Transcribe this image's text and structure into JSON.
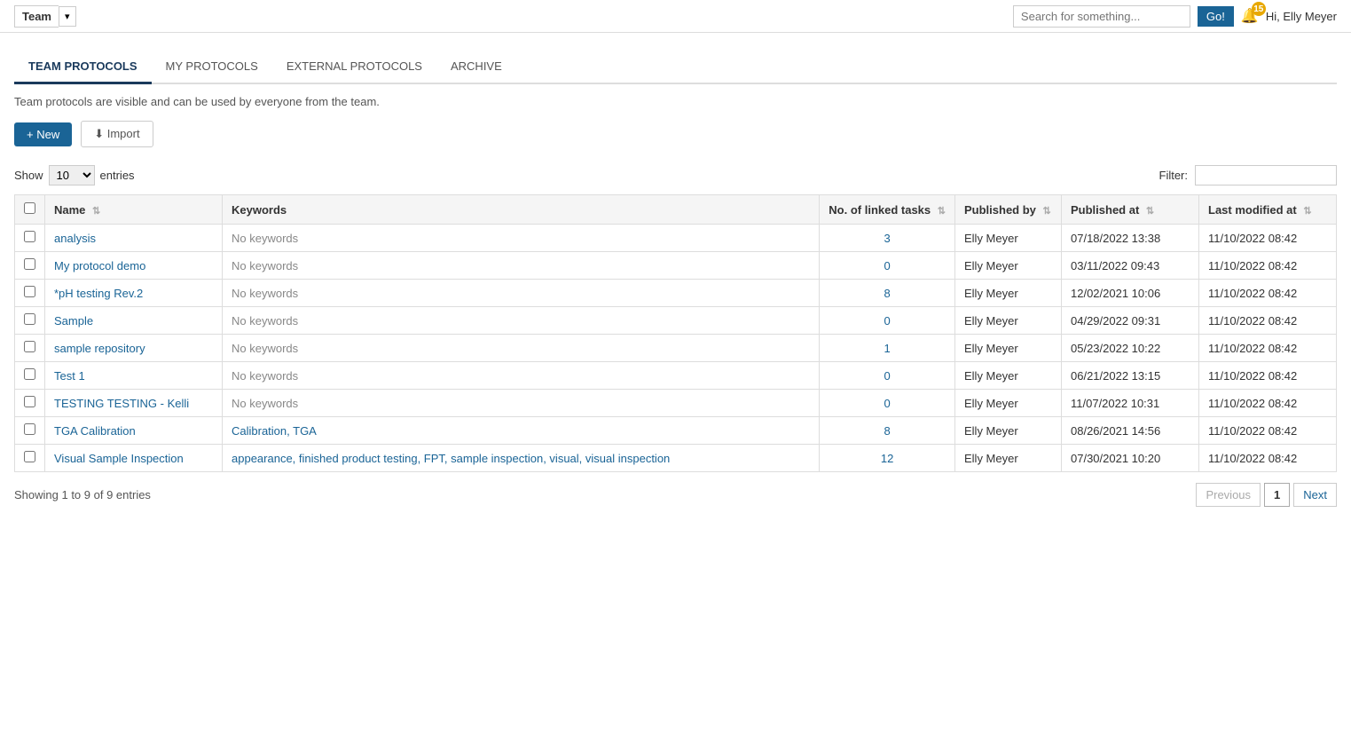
{
  "header": {
    "team_label": "Team",
    "dropdown_icon": "▾",
    "search_placeholder": "Search for something...",
    "go_label": "Go!",
    "notification_count": "15",
    "user_greeting": "Hi, Elly Meyer"
  },
  "tabs": [
    {
      "id": "team-protocols",
      "label": "TEAM PROTOCOLS",
      "active": true
    },
    {
      "id": "my-protocols",
      "label": "MY PROTOCOLS",
      "active": false
    },
    {
      "id": "external-protocols",
      "label": "EXTERNAL PROTOCOLS",
      "active": false
    },
    {
      "id": "archive",
      "label": "ARCHIVE",
      "active": false
    }
  ],
  "description": "Team protocols are visible and can be used by everyone from the team.",
  "buttons": {
    "new_label": "+ New",
    "import_label": "⬇ Import"
  },
  "table_controls": {
    "show_label": "Show",
    "entries_label": "entries",
    "entries_value": "10",
    "filter_label": "Filter:"
  },
  "table": {
    "columns": [
      {
        "id": "checkbox",
        "label": ""
      },
      {
        "id": "name",
        "label": "Name"
      },
      {
        "id": "keywords",
        "label": "Keywords"
      },
      {
        "id": "linked_tasks",
        "label": "No. of linked tasks"
      },
      {
        "id": "published_by",
        "label": "Published by"
      },
      {
        "id": "published_at",
        "label": "Published at"
      },
      {
        "id": "last_modified",
        "label": "Last modified at"
      }
    ],
    "rows": [
      {
        "name": "analysis",
        "keywords": "No keywords",
        "linked_tasks": "3",
        "published_by": "Elly Meyer",
        "published_at": "07/18/2022 13:38",
        "last_modified": "11/10/2022 08:42"
      },
      {
        "name": "My protocol demo",
        "keywords": "No keywords",
        "linked_tasks": "0",
        "published_by": "Elly Meyer",
        "published_at": "03/11/2022 09:43",
        "last_modified": "11/10/2022 08:42"
      },
      {
        "name": "*pH testing Rev.2",
        "keywords": "No keywords",
        "linked_tasks": "8",
        "published_by": "Elly Meyer",
        "published_at": "12/02/2021 10:06",
        "last_modified": "11/10/2022 08:42"
      },
      {
        "name": "Sample",
        "keywords": "No keywords",
        "linked_tasks": "0",
        "published_by": "Elly Meyer",
        "published_at": "04/29/2022 09:31",
        "last_modified": "11/10/2022 08:42"
      },
      {
        "name": "sample repository",
        "keywords": "No keywords",
        "linked_tasks": "1",
        "published_by": "Elly Meyer",
        "published_at": "05/23/2022 10:22",
        "last_modified": "11/10/2022 08:42"
      },
      {
        "name": "Test 1",
        "keywords": "No keywords",
        "linked_tasks": "0",
        "published_by": "Elly Meyer",
        "published_at": "06/21/2022 13:15",
        "last_modified": "11/10/2022 08:42"
      },
      {
        "name": "TESTING TESTING - Kelli",
        "keywords": "No keywords",
        "linked_tasks": "0",
        "published_by": "Elly Meyer",
        "published_at": "11/07/2022 10:31",
        "last_modified": "11/10/2022 08:42"
      },
      {
        "name": "TGA Calibration",
        "keywords": "Calibration, TGA",
        "linked_tasks": "8",
        "published_by": "Elly Meyer",
        "published_at": "08/26/2021 14:56",
        "last_modified": "11/10/2022 08:42"
      },
      {
        "name": "Visual Sample Inspection",
        "keywords": "appearance, finished product testing, FPT, sample inspection, visual, visual inspection",
        "linked_tasks": "12",
        "published_by": "Elly Meyer",
        "published_at": "07/30/2021 10:20",
        "last_modified": "11/10/2022 08:42"
      }
    ]
  },
  "pagination": {
    "showing_text": "Showing 1 to 9 of 9 entries",
    "previous_label": "Previous",
    "next_label": "Next",
    "current_page": "1"
  }
}
